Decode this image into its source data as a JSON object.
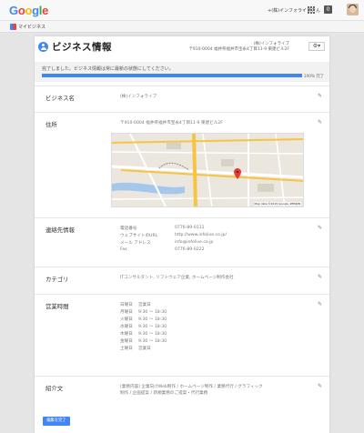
{
  "topbar": {
    "logo_letters": [
      {
        "ch": "G",
        "color": "#4285f4"
      },
      {
        "ch": "o",
        "color": "#ea4335"
      },
      {
        "ch": "o",
        "color": "#fbbc05"
      },
      {
        "ch": "g",
        "color": "#4285f4"
      },
      {
        "ch": "l",
        "color": "#34a853"
      },
      {
        "ch": "e",
        "color": "#ea4335"
      }
    ],
    "user_name": "+(株)インフォライブさん",
    "notif_count": "0"
  },
  "subbar": {
    "tab_label": "マイビジネス"
  },
  "header": {
    "title": "ビジネス情報",
    "biz_name": "(株)インフォライブ",
    "biz_address": "〒910-0004 福井県福井市宝永4丁目11-9 東建ビル2F"
  },
  "progress": {
    "message": "完了しました。ビジネス情報は常に最新の状態にしてください。",
    "percent_label": "100% 完了",
    "fraction": 1.0
  },
  "rows": {
    "name": {
      "label": "ビジネス名",
      "value": "(株)インフォライブ"
    },
    "address": {
      "label": "住所",
      "value": "〒910-0004 福井県福井市宝永4丁目11-9 東建ビル2F",
      "map_credit": "Map data ©2015 Google, ZENRIN"
    },
    "contact": {
      "label": "連絡先情報",
      "items": [
        {
          "k": "電話番号",
          "v": "0776-89-0111"
        },
        {
          "k": "ウェブサイトのURL",
          "v": "http://www.infolive.co.jp/"
        },
        {
          "k": "メール アドレス",
          "v": "info@infolive.co.jp"
        },
        {
          "k": "Fax",
          "v": "0776-89-0222"
        }
      ]
    },
    "category": {
      "label": "カテゴリ",
      "value": "ITコンサルタント, ソフトウェア企業, ホームページ制作会社"
    },
    "hours": {
      "label": "営業時間",
      "items": [
        {
          "d": "日曜日",
          "h": "営業日"
        },
        {
          "d": "月曜日",
          "h": "9:30 〜 18:30"
        },
        {
          "d": "火曜日",
          "h": "9:30 〜 18:30"
        },
        {
          "d": "水曜日",
          "h": "9:30 〜 18:30"
        },
        {
          "d": "木曜日",
          "h": "9:30 〜 18:30"
        },
        {
          "d": "金曜日",
          "h": "9:30 〜 18:30"
        },
        {
          "d": "土曜日",
          "h": "営業日"
        }
      ]
    },
    "intro": {
      "label": "紹介文",
      "line1": "[業務内容] 企業向けWeb制作 / ホームページ制作 / 業務代行 / グラフィック",
      "line2": "制作 / 企画提案 / 新規業務のご提案・代行業務"
    }
  },
  "footer": {
    "edit_button": "編集を完了"
  }
}
